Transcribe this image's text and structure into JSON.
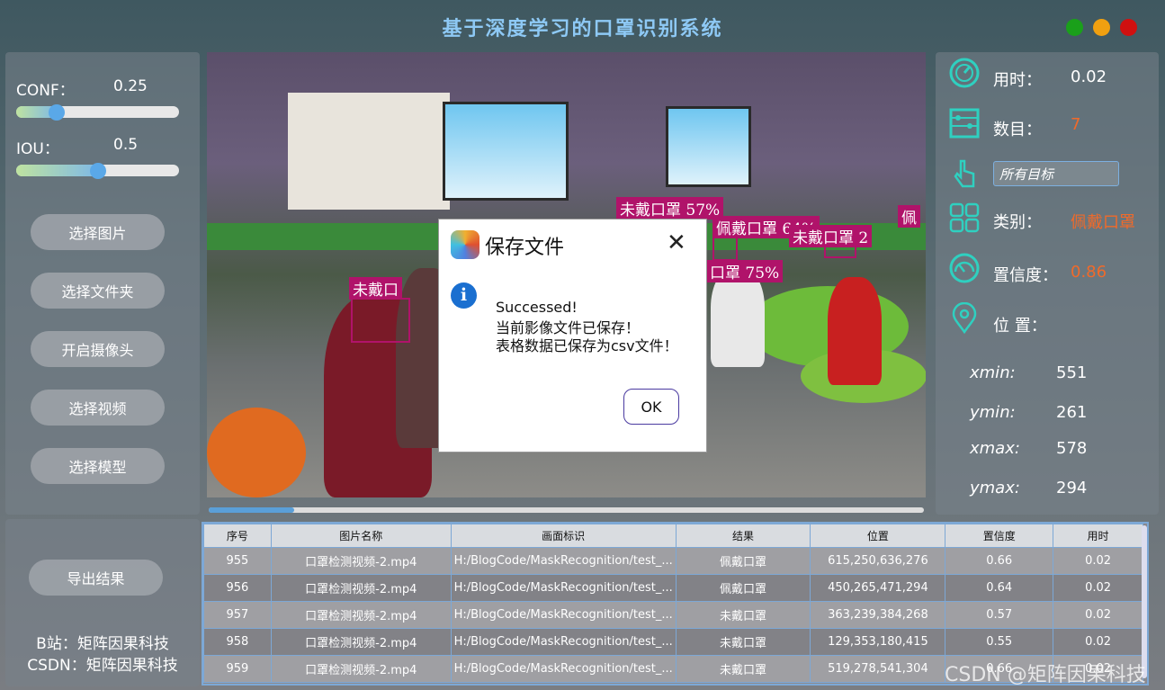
{
  "app": {
    "title": "基于深度学习的口罩识别系统"
  },
  "window_buttons": {
    "green": "#1aa01a",
    "yellow": "#f0a010",
    "red": "#d01010"
  },
  "sliders": {
    "conf": {
      "label": "CONF：",
      "value": "0.25",
      "fraction": 0.25
    },
    "iou": {
      "label": "IOU：",
      "value": "0.5",
      "fraction": 0.5
    }
  },
  "buttons": {
    "select_image": "选择图片",
    "select_folder": "选择文件夹",
    "open_camera": "开启摄像头",
    "select_video": "选择视频",
    "select_model": "选择模型",
    "export_results": "导出结果"
  },
  "credits": {
    "bilibili": "B站：矩阵因果科技",
    "csdn": "CSDN：矩阵因果科技"
  },
  "detections": [
    {
      "text": "未戴口罩 57%"
    },
    {
      "text": "佩戴口罩 64%"
    },
    {
      "text": "未戴口罩 2"
    },
    {
      "text": "佩"
    },
    {
      "text": "口罩 75%"
    },
    {
      "text": "未戴口"
    }
  ],
  "video": {
    "progress_fraction": 0.12
  },
  "dialog": {
    "title": "保存文件",
    "close": "✕",
    "info_glyph": "i",
    "line1": "Successed!",
    "line2": "当前影像文件已保存！",
    "line3": "表格数据已保存为csv文件！",
    "ok": "OK"
  },
  "info": {
    "time_label": "用时：",
    "time_value": "0.02",
    "count_label": "数目：",
    "count_value": "7",
    "target_select": "所有目标",
    "class_label": "类别：",
    "class_value": "佩戴口罩",
    "conf_label": "置信度：",
    "conf_value": "0.86",
    "pos_label": "位 置：",
    "xmin_label": "xmin:",
    "xmin_value": "551",
    "ymin_label": "ymin:",
    "ymin_value": "261",
    "xmax_label": "xmax:",
    "xmax_value": "578",
    "ymax_label": "ymax:",
    "ymax_value": "294",
    "accent_color": "#f06a2a"
  },
  "table": {
    "headers": [
      "序号",
      "图片名称",
      "画面标识",
      "结果",
      "位置",
      "置信度",
      "用时"
    ],
    "rows": [
      [
        "955",
        "口罩检测视频-2.mp4",
        "H:/BlogCode/MaskRecognition/test_...",
        "佩戴口罩",
        "615,250,636,276",
        "0.66",
        "0.02"
      ],
      [
        "956",
        "口罩检测视频-2.mp4",
        "H:/BlogCode/MaskRecognition/test_...",
        "佩戴口罩",
        "450,265,471,294",
        "0.64",
        "0.02"
      ],
      [
        "957",
        "口罩检测视频-2.mp4",
        "H:/BlogCode/MaskRecognition/test_...",
        "未戴口罩",
        "363,239,384,268",
        "0.57",
        "0.02"
      ],
      [
        "958",
        "口罩检测视频-2.mp4",
        "H:/BlogCode/MaskRecognition/test_...",
        "未戴口罩",
        "129,353,180,415",
        "0.55",
        "0.02"
      ],
      [
        "959",
        "口罩检测视频-2.mp4",
        "H:/BlogCode/MaskRecognition/test_...",
        "未戴口罩",
        "519,278,541,304",
        "0.66",
        "0.02"
      ]
    ]
  },
  "watermark": "CSDN @矩阵因果科技"
}
